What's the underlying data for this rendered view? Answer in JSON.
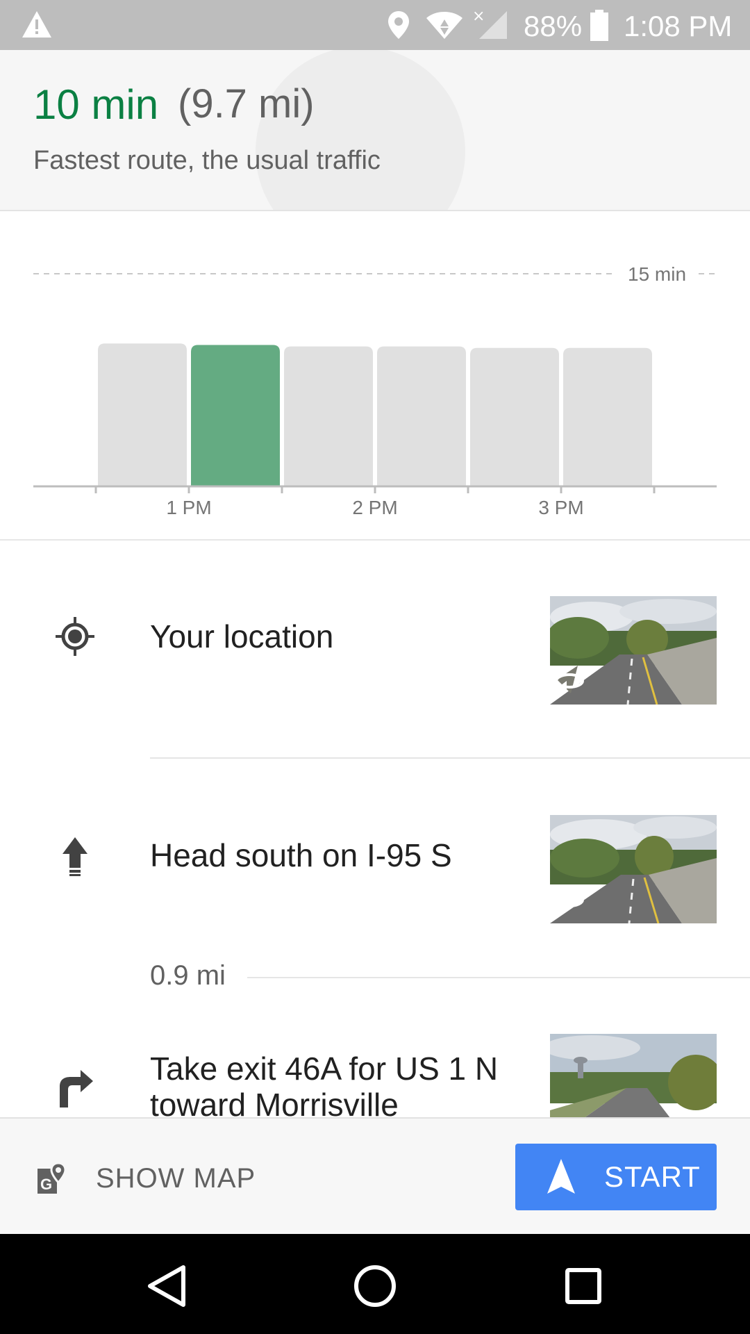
{
  "status_bar": {
    "battery": "88%",
    "time": "1:08 PM",
    "icons": [
      "warning-icon",
      "location-icon",
      "wifi-icon",
      "signal-icon",
      "battery-icon"
    ]
  },
  "summary": {
    "duration": "10 min",
    "distance": "(9.7 mi)",
    "description": "Fastest route, the usual traffic"
  },
  "chart_data": {
    "type": "bar",
    "reference_line_label": "15 min",
    "tick_labels": [
      "1 PM",
      "2 PM",
      "3 PM"
    ],
    "bar_count": 6,
    "highlighted_index": 1,
    "values_relative": [
      0.97,
      0.96,
      0.95,
      0.95,
      0.94,
      0.94
    ],
    "colors": {
      "highlight": "#64ab82",
      "default": "#e0e0e0"
    }
  },
  "steps": [
    {
      "icon": "my-location-icon",
      "text_lines": [
        "Your location"
      ]
    },
    {
      "icon": "arrow-up-icon",
      "text_lines": [
        "Head south on I-95 S"
      ],
      "distance": "0.9 mi"
    },
    {
      "icon": "turn-right-icon",
      "text_lines": [
        "Take exit 46A for US 1 N",
        "toward Morrisville"
      ]
    }
  ],
  "actions": {
    "show_map": "SHOW MAP",
    "start": "START"
  },
  "colors": {
    "accent_green": "#0b8043",
    "start_blue": "#4285f4"
  }
}
